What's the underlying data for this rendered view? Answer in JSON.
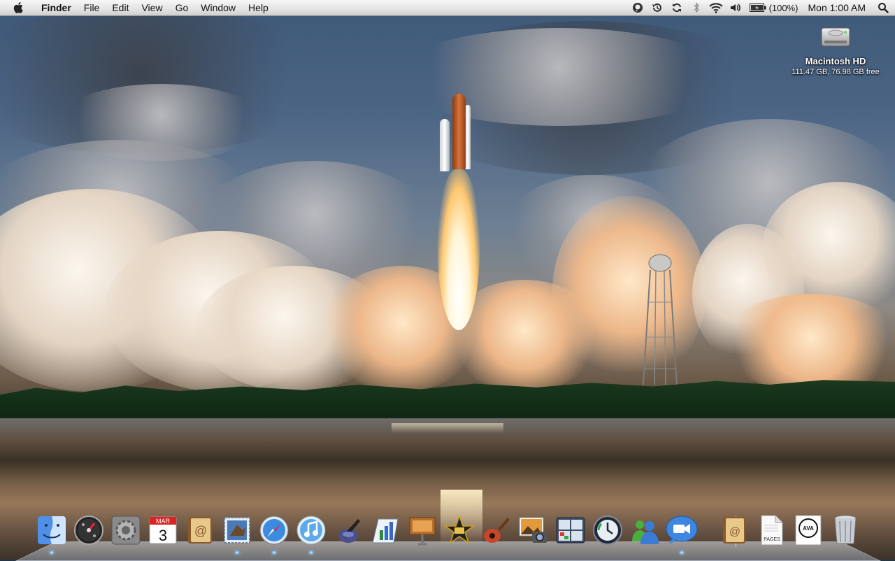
{
  "menubar": {
    "app_name": "Finder",
    "menus": [
      "File",
      "Edit",
      "View",
      "Go",
      "Window",
      "Help"
    ],
    "extras": [
      "ichat-status-icon",
      "time-machine-icon",
      "sync-icon",
      "bluetooth-icon",
      "wifi-icon",
      "volume-icon"
    ],
    "battery_percent": "(100%)",
    "clock": "Mon 1:00 AM"
  },
  "desktop": {
    "drive_name": "Macintosh HD",
    "drive_info": "111.47 GB, 76.98 GB free"
  },
  "dock": {
    "apps": [
      {
        "icon": "finder-icon",
        "running": true
      },
      {
        "icon": "dashboard-icon",
        "running": false
      },
      {
        "icon": "system-preferences-icon",
        "running": false
      },
      {
        "icon": "ical-icon",
        "running": false,
        "month": "MAR",
        "day": "3"
      },
      {
        "icon": "address-book-icon",
        "running": false
      },
      {
        "icon": "mail-icon",
        "running": true
      },
      {
        "icon": "safari-icon",
        "running": true
      },
      {
        "icon": "itunes-icon",
        "running": true
      },
      {
        "icon": "script-editor-icon",
        "running": false
      },
      {
        "icon": "numbers-icon",
        "running": false
      },
      {
        "icon": "keynote-icon",
        "running": false
      },
      {
        "icon": "imovie-icon",
        "running": false
      },
      {
        "icon": "garageband-icon",
        "running": false
      },
      {
        "icon": "iphoto-icon",
        "running": false
      },
      {
        "icon": "spaces-icon",
        "running": false
      },
      {
        "icon": "time-machine-icon",
        "running": false
      },
      {
        "icon": "messenger-icon",
        "running": false
      },
      {
        "icon": "facetime-icon",
        "running": true
      }
    ],
    "docs": [
      {
        "icon": "address-book-doc-icon"
      },
      {
        "icon": "pages-doc-icon",
        "label": "PAGES"
      },
      {
        "icon": "ava-doc-icon",
        "label": "AVA"
      },
      {
        "icon": "trash-icon"
      }
    ]
  }
}
